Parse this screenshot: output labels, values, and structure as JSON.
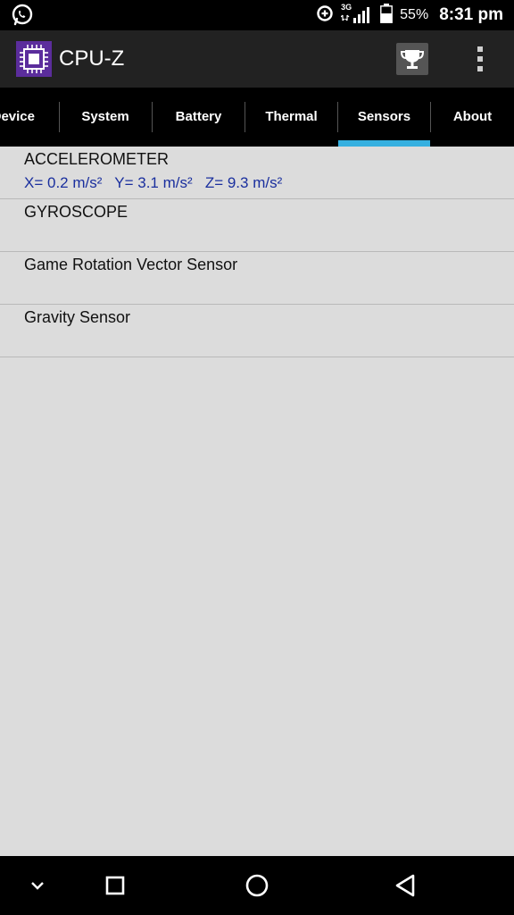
{
  "status_bar": {
    "battery_percent": "55%",
    "time": "8:31 pm",
    "network": "3G",
    "icons": [
      "whatsapp-icon",
      "data-saver-icon",
      "signal-icon",
      "battery-icon"
    ]
  },
  "app_bar": {
    "title": "CPU-Z",
    "icons": [
      "cpu-logo-icon",
      "trophy-icon",
      "overflow-menu-icon"
    ]
  },
  "tabs": [
    {
      "label": "Device"
    },
    {
      "label": "System"
    },
    {
      "label": "Battery"
    },
    {
      "label": "Thermal"
    },
    {
      "label": "Sensors",
      "selected": true
    },
    {
      "label": "About"
    }
  ],
  "sensors": [
    {
      "name": "ACCELEROMETER",
      "values": "X= 0.2 m/s²   Y= 3.1 m/s²   Z= 9.3 m/s²"
    },
    {
      "name": "GYROSCOPE",
      "values": ""
    },
    {
      "name": "Game Rotation Vector Sensor",
      "values": ""
    },
    {
      "name": "Gravity Sensor",
      "values": ""
    }
  ],
  "nav_bar": {
    "icons": [
      "hide-keyboard-icon",
      "recents-icon",
      "home-icon",
      "back-icon"
    ]
  },
  "colors": {
    "accent": "#35b0e0",
    "value_text": "#1a2f9e",
    "logo_bg": "#5b2d9c"
  }
}
